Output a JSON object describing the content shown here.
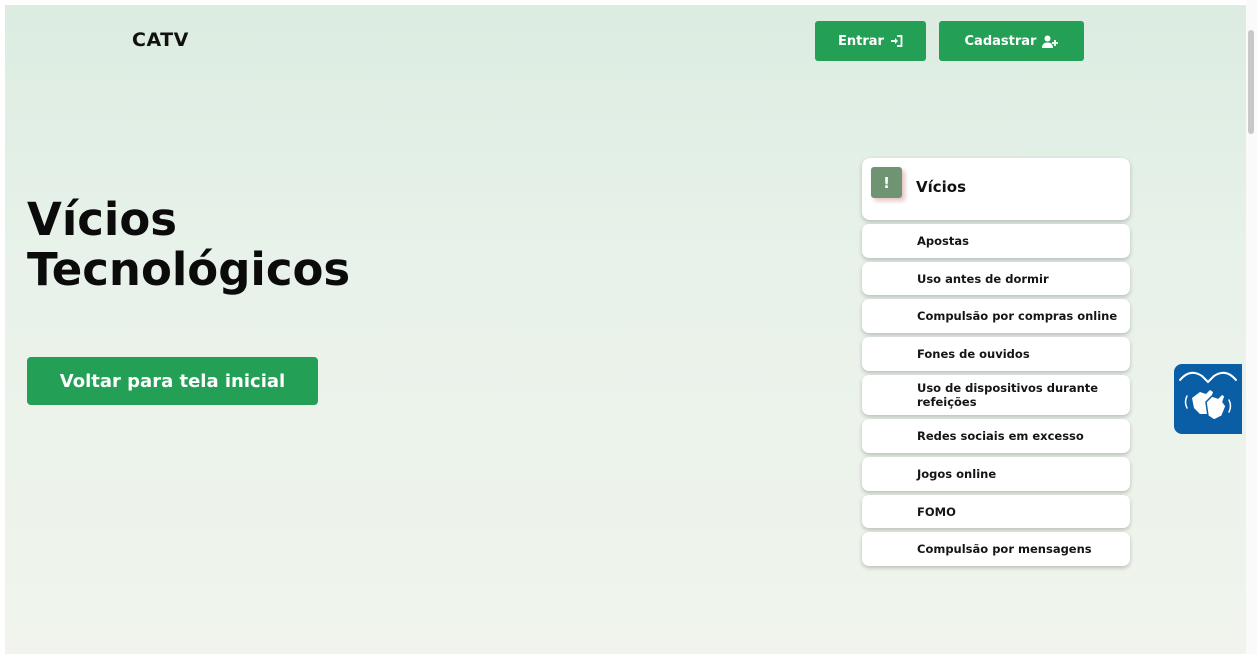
{
  "header": {
    "logo": "CATV",
    "login_label": "Entrar",
    "register_label": "Cadastrar",
    "login_icon": "sign-in-icon",
    "register_icon": "user-plus-icon"
  },
  "hero": {
    "title_line1": "Vícios",
    "title_line2": "Tecnológicos",
    "back_button": "Voltar para tela inicial"
  },
  "menu": {
    "badge": "!",
    "title": "Vícios",
    "items": [
      "Apostas",
      "Uso antes de dormir",
      "Compulsão por compras online",
      "Fones de ouvidos",
      "Uso de dispositivos durante refeições",
      "Redes sociais em excesso",
      "Jogos online",
      "FOMO",
      "Compulsão por mensagens"
    ]
  },
  "accessibility": {
    "widget_icon": "sign-language-hands-icon"
  },
  "colors": {
    "accent": "#23a055",
    "badge": "#6f9472",
    "vlibras": "#0a5ea6"
  }
}
